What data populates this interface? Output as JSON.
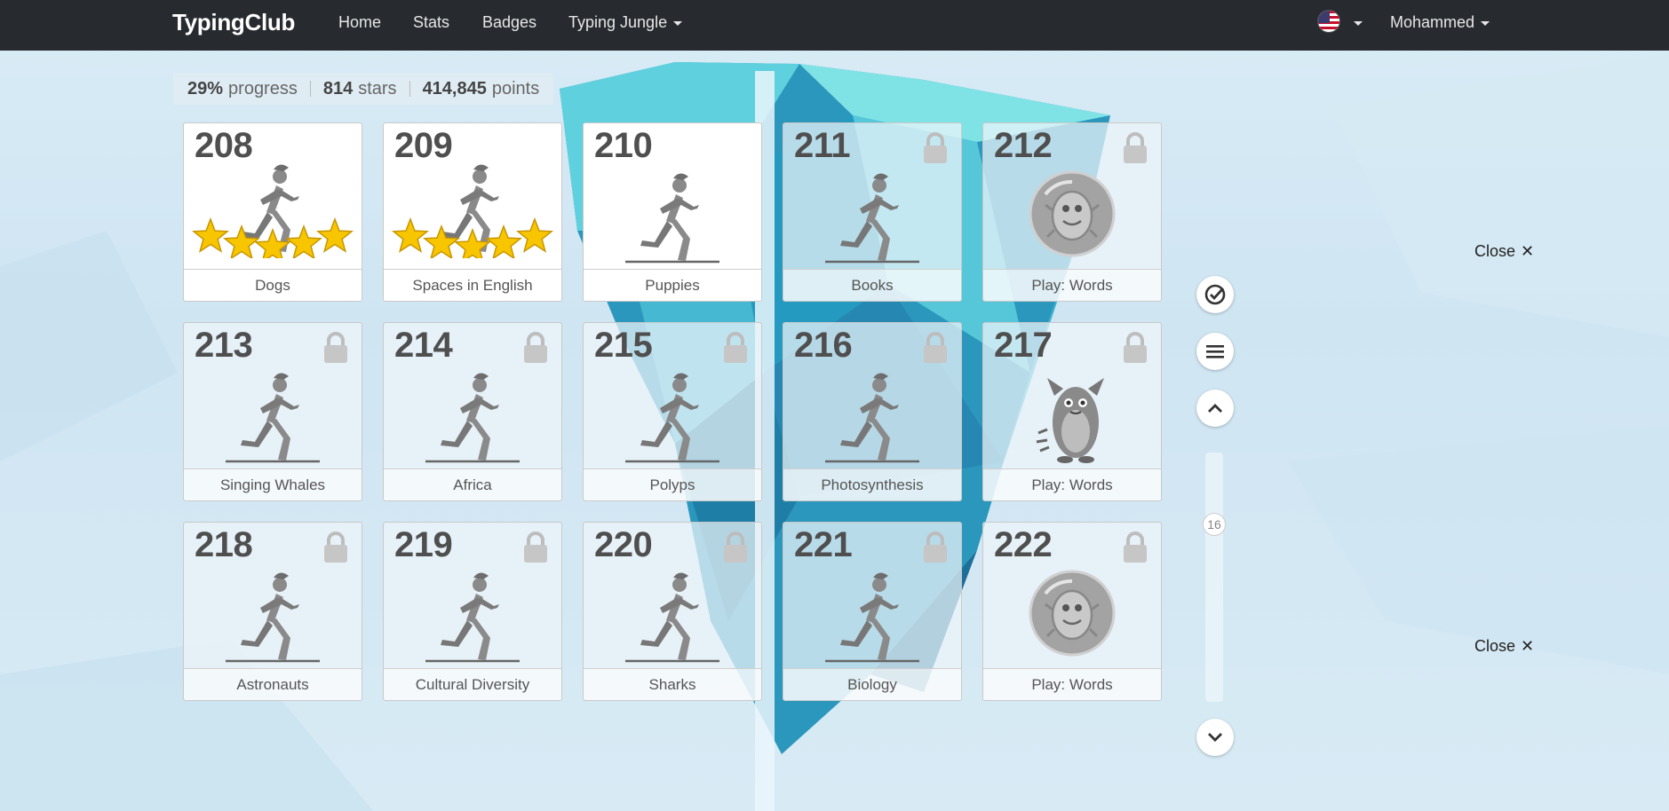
{
  "nav": {
    "brand": "TypingClub",
    "links": [
      "Home",
      "Stats",
      "Badges",
      "Typing Jungle"
    ],
    "user": "Mohammed"
  },
  "summary": {
    "progress_value": "29%",
    "progress_label": "progress",
    "stars_value": "814",
    "stars_label": "stars",
    "points_value": "414,845",
    "points_label": "points"
  },
  "lessons": [
    {
      "number": "208",
      "title": "Dogs",
      "state": "unlocked",
      "stars": 5,
      "icon": "runner-icon"
    },
    {
      "number": "209",
      "title": "Spaces in English",
      "state": "unlocked",
      "stars": 5,
      "icon": "runner-icon"
    },
    {
      "number": "210",
      "title": "Puppies",
      "state": "unlocked",
      "stars": 0,
      "icon": "runner-icon"
    },
    {
      "number": "211",
      "title": "Books",
      "state": "locked",
      "stars": 0,
      "icon": "runner-icon"
    },
    {
      "number": "212",
      "title": "Play: Words",
      "state": "locked",
      "stars": 0,
      "icon": "bug-game-icon"
    },
    {
      "number": "213",
      "title": "Singing Whales",
      "state": "locked",
      "stars": 0,
      "icon": "runner-icon"
    },
    {
      "number": "214",
      "title": "Africa",
      "state": "locked",
      "stars": 0,
      "icon": "runner-icon"
    },
    {
      "number": "215",
      "title": "Polyps",
      "state": "locked",
      "stars": 0,
      "icon": "runner-icon"
    },
    {
      "number": "216",
      "title": "Photosynthesis",
      "state": "locked",
      "stars": 0,
      "icon": "runner-icon"
    },
    {
      "number": "217",
      "title": "Play: Words",
      "state": "locked",
      "stars": 0,
      "icon": "monster-game-icon"
    },
    {
      "number": "218",
      "title": "Astronauts",
      "state": "locked",
      "stars": 0,
      "icon": "runner-icon"
    },
    {
      "number": "219",
      "title": "Cultural Diversity",
      "state": "locked",
      "stars": 0,
      "icon": "runner-icon"
    },
    {
      "number": "220",
      "title": "Sharks",
      "state": "locked",
      "stars": 0,
      "icon": "runner-icon"
    },
    {
      "number": "221",
      "title": "Biology",
      "state": "locked",
      "stars": 0,
      "icon": "runner-icon"
    },
    {
      "number": "222",
      "title": "Play: Words",
      "state": "locked",
      "stars": 0,
      "icon": "bug-game-icon"
    }
  ],
  "controls": {
    "scroll_page": "16",
    "close_label": "Close",
    "close_symbol": "✕"
  },
  "colors": {
    "navbar": "#272b30",
    "star": "#f7c600",
    "iceberg": "#2e9fc4"
  }
}
